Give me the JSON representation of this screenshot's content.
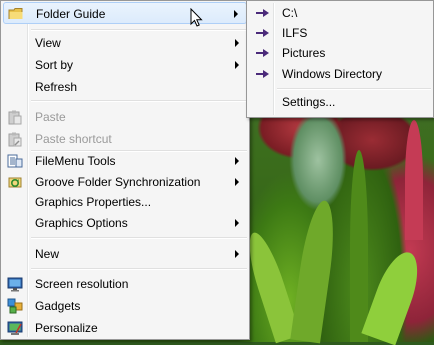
{
  "context_menu": {
    "items": [
      {
        "label": "Folder Guide",
        "icon": "folder-icon",
        "submenu": true,
        "highlighted": true
      },
      {
        "label": "View",
        "submenu": true
      },
      {
        "label": "Sort by",
        "submenu": true
      },
      {
        "label": "Refresh"
      },
      {
        "label": "Paste",
        "icon": "paste-icon",
        "disabled": true
      },
      {
        "label": "Paste shortcut",
        "icon": "paste-shortcut-icon",
        "disabled": true
      },
      {
        "label": "FileMenu Tools",
        "icon": "filemenu-tools-icon",
        "submenu": true
      },
      {
        "label": "Groove Folder Synchronization",
        "icon": "groove-sync-icon",
        "submenu": true
      },
      {
        "label": "Graphics Properties..."
      },
      {
        "label": "Graphics Options",
        "submenu": true
      },
      {
        "label": "New",
        "submenu": true
      },
      {
        "label": "Screen resolution",
        "icon": "screen-resolution-icon"
      },
      {
        "label": "Gadgets",
        "icon": "gadgets-icon"
      },
      {
        "label": "Personalize",
        "icon": "personalize-icon"
      }
    ]
  },
  "folder_guide_submenu": {
    "items": [
      {
        "label": "C:\\",
        "icon": "purple-arrow-icon"
      },
      {
        "label": "ILFS",
        "icon": "purple-arrow-icon"
      },
      {
        "label": "Pictures",
        "icon": "purple-arrow-icon"
      },
      {
        "label": "Windows Directory",
        "icon": "purple-arrow-icon"
      },
      {
        "label": "Settings..."
      }
    ]
  },
  "colors": {
    "menu_bg": "#f5f5f5",
    "hover": "#dcebfc",
    "disabled_text": "#9a9a9a",
    "arrow_purple": "#4b2a7a"
  }
}
